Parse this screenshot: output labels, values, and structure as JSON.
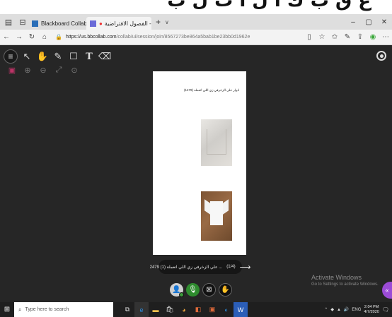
{
  "tabs": [
    {
      "label": "Blackboard Collaborate Ultr",
      "favicon_color": "#2a6eb8",
      "active": false
    },
    {
      "label": "الفصول الافتراضية -",
      "favicon_color": "#6b6bd8",
      "active": true,
      "recording": "●"
    }
  ],
  "tabbar": {
    "new_tab": "+",
    "dropdown": "∨",
    "minimize": "–",
    "maximize": "▢",
    "close": "✕",
    "close_tab": "✕"
  },
  "address": {
    "host": "https://us.bbcollab.com",
    "path": "/collab/ui/session/join/8567273be864a5bab1be23bb0d1962e",
    "lock_icon": "lock-icon"
  },
  "toolbar_icons": [
    "menu-icon",
    "pointer-icon",
    "hand-icon",
    "pen-icon",
    "square-icon",
    "text-icon",
    "eraser-icon"
  ],
  "zoom_icons": [
    "fit-page-icon",
    "zoom-in-icon",
    "zoom-out-icon",
    "fullscreen-icon",
    "zoom-reset-icon"
  ],
  "document": {
    "title": "ادوار على الزخرفي زي اللي اتعمله (1479)"
  },
  "file_pill": {
    "page": "(1/4)",
    "name": "... علي الزخرفي زي اللي اتعملة (1) 2479"
  },
  "watermark": {
    "line1": "Activate Windows",
    "line2": "Go to Settings to activate Windows."
  },
  "session_controls": [
    "avatar-icon",
    "microphone-icon",
    "camera-icon",
    "raise-hand-icon"
  ],
  "taskbar": {
    "search_placeholder": "Type here to search",
    "time": "2:04 PM",
    "date": "4/7/2020",
    "lang": "ENG"
  },
  "colors": {
    "app_bg": "#262626",
    "accent_purple": "#9b4bd6",
    "mic_green": "#2e8b2e"
  }
}
